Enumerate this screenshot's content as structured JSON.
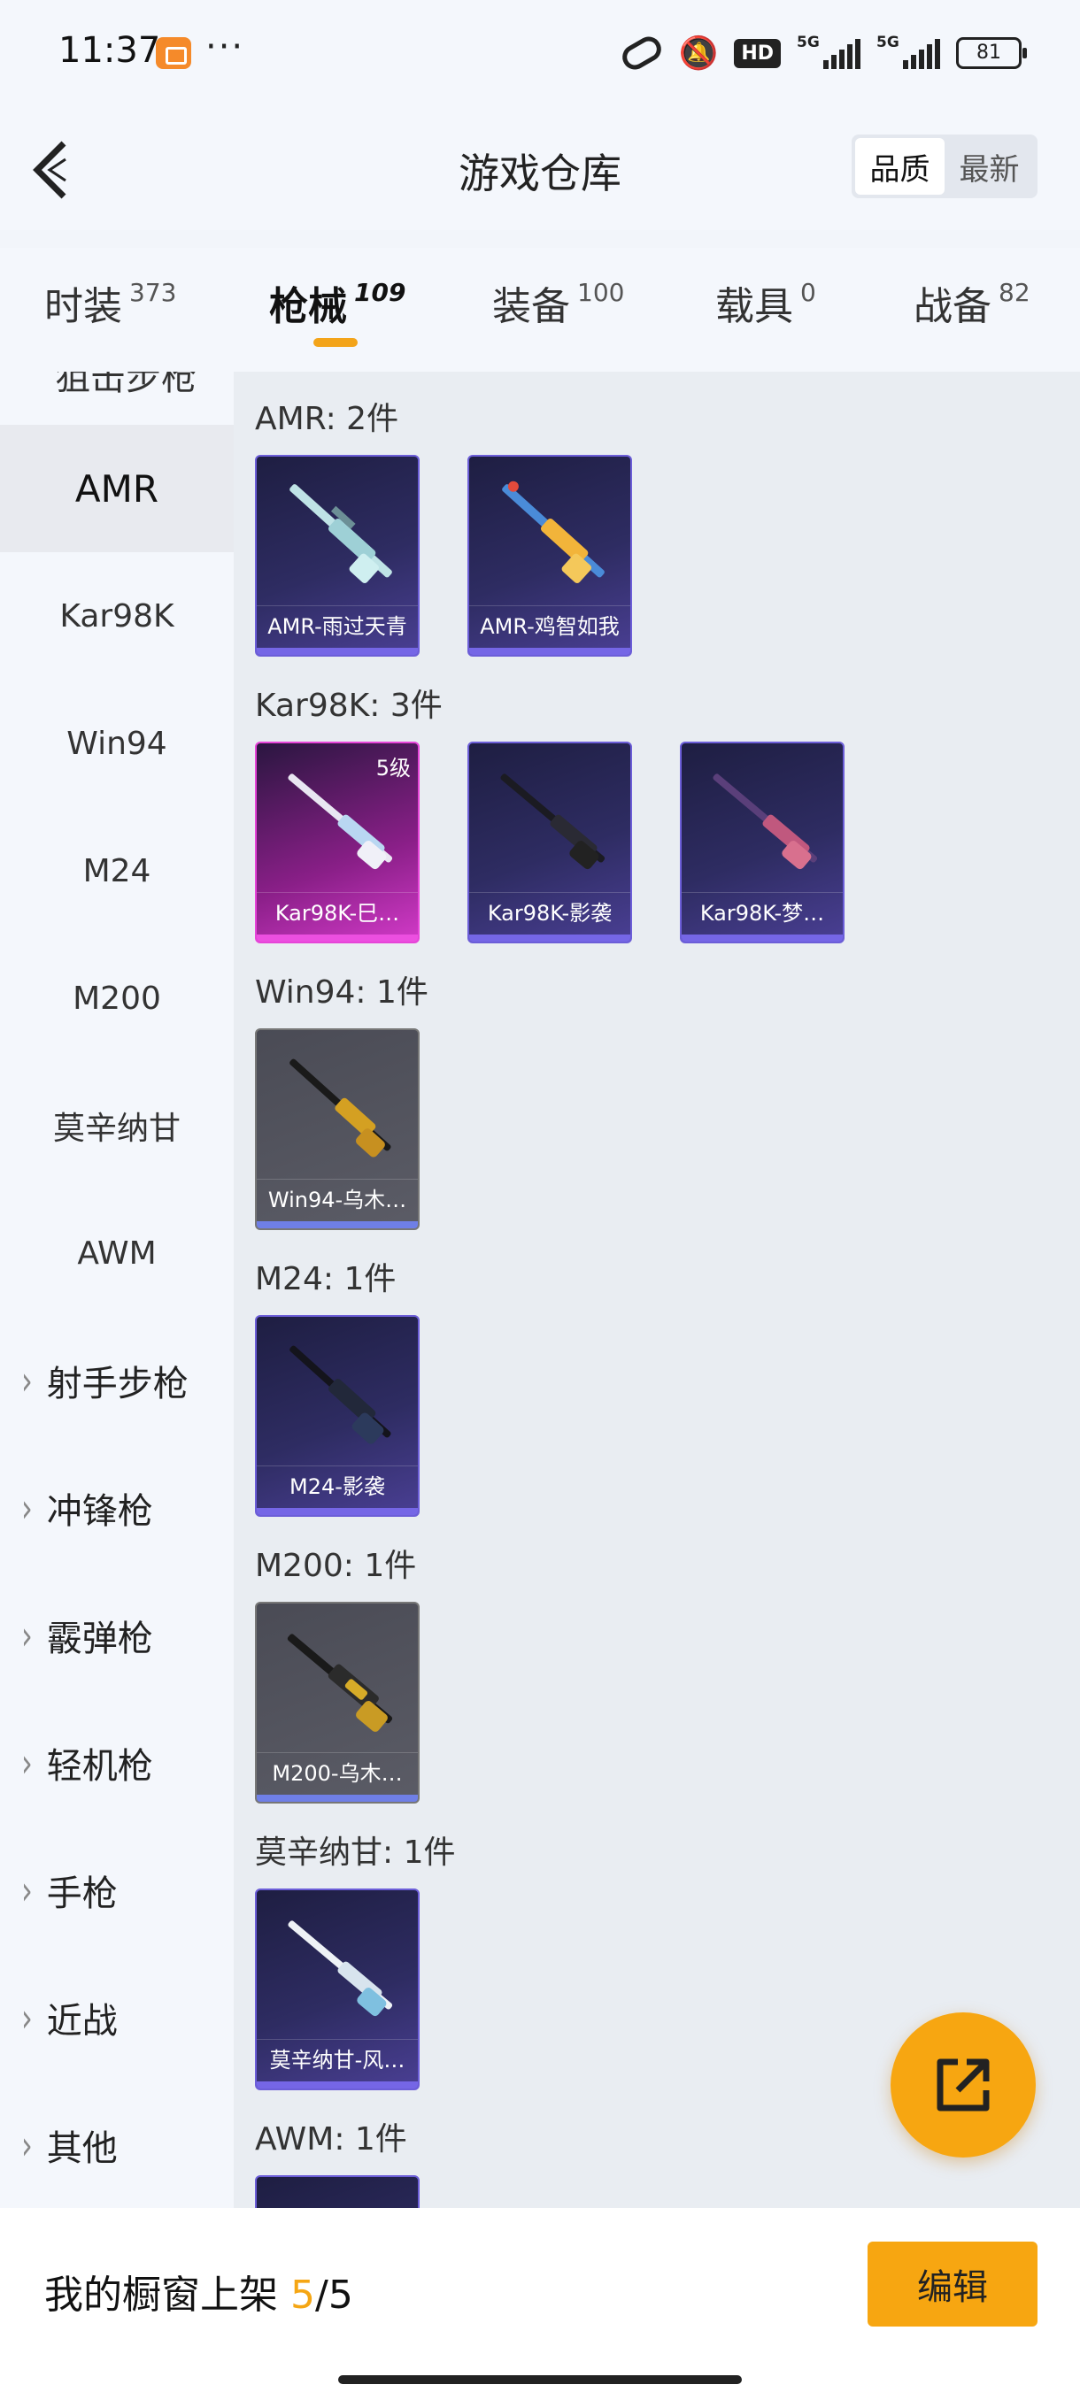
{
  "status_bar": {
    "time": "11:37",
    "more": "···",
    "network_label": "5G",
    "hd_label": "HD",
    "battery": "81"
  },
  "header": {
    "title": "游戏仓库",
    "sort_quality": "品质",
    "sort_newest": "最新"
  },
  "tabs": [
    {
      "label": "时装",
      "count": "373"
    },
    {
      "label": "枪械",
      "count": "109"
    },
    {
      "label": "装备",
      "count": "100"
    },
    {
      "label": "载具",
      "count": "0"
    },
    {
      "label": "战备",
      "count": "82"
    }
  ],
  "sidebar": {
    "cut_label": "狙击步枪",
    "weapons": [
      "AMR",
      "Kar98K",
      "Win94",
      "M24",
      "M200",
      "莫辛纳甘",
      "AWM"
    ],
    "categories": [
      "射手步枪",
      "冲锋枪",
      "霰弹枪",
      "轻机枪",
      "手枪",
      "近战",
      "其他"
    ]
  },
  "sections": [
    {
      "title": "AMR: 2件",
      "items": [
        {
          "name": "AMR-雨过天青"
        },
        {
          "name": "AMR-鸡智如我"
        }
      ]
    },
    {
      "title": "Kar98K: 3件",
      "items": [
        {
          "name": "Kar98K-巳…",
          "level": "5级"
        },
        {
          "name": "Kar98K-影袭"
        },
        {
          "name": "Kar98K-梦…"
        }
      ]
    },
    {
      "title": "Win94: 1件",
      "items": [
        {
          "name": "Win94-乌木…"
        }
      ]
    },
    {
      "title": "M24: 1件",
      "items": [
        {
          "name": "M24-影袭"
        }
      ]
    },
    {
      "title": "M200: 1件",
      "items": [
        {
          "name": "M200-乌木…"
        }
      ]
    },
    {
      "title": "莫辛纳甘: 1件",
      "items": [
        {
          "name": "莫辛纳甘-风…"
        }
      ]
    },
    {
      "title": "AWM: 1件",
      "items": []
    }
  ],
  "bottom": {
    "label": "我的橱窗上架 ",
    "current": "5",
    "total": "/5",
    "edit": "编辑"
  },
  "colors": {
    "accent": "#f7a611",
    "purple_rarity": "#7566e6",
    "pink_rarity": "#ec4fe0"
  }
}
